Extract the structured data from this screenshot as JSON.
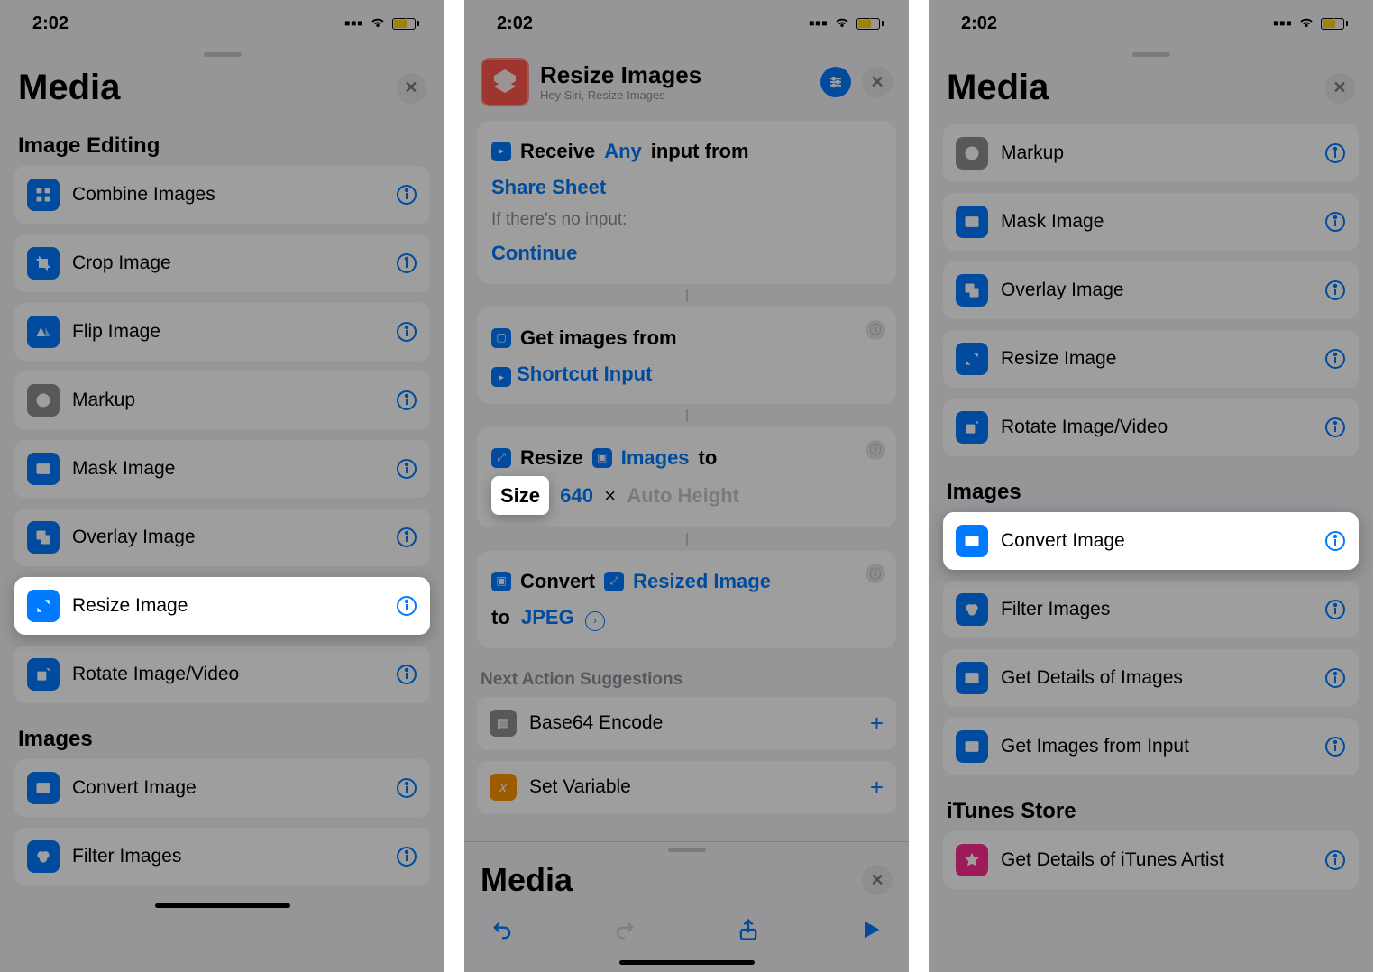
{
  "status": {
    "time": "2:02"
  },
  "phone1": {
    "sheet_title": "Media",
    "sections": [
      {
        "title": "Image Editing",
        "items": [
          {
            "icon": "grid",
            "label": "Combine Images"
          },
          {
            "icon": "crop",
            "label": "Crop Image"
          },
          {
            "icon": "flip",
            "label": "Flip Image"
          },
          {
            "icon": "markup",
            "label": "Markup",
            "gray": true
          },
          {
            "icon": "mask",
            "label": "Mask Image"
          },
          {
            "icon": "overlay",
            "label": "Overlay Image"
          },
          {
            "icon": "resize",
            "label": "Resize Image",
            "highlight": true
          },
          {
            "icon": "rotate",
            "label": "Rotate Image/Video"
          }
        ]
      },
      {
        "title": "Images",
        "items": [
          {
            "icon": "convert",
            "label": "Convert Image"
          },
          {
            "icon": "filter",
            "label": "Filter Images"
          }
        ]
      }
    ]
  },
  "phone2": {
    "shortcut_name": "Resize Images",
    "shortcut_sub": "Hey Siri, Resize Images",
    "receive": {
      "pre": "Receive",
      "any": "Any",
      "post": "input from",
      "share_sheet": "Share Sheet",
      "if_none": "If there's no input:",
      "continue": "Continue"
    },
    "get_images": {
      "text": "Get images from",
      "input": "Shortcut Input"
    },
    "resize": {
      "verb": "Resize",
      "var": "Images",
      "to": "to",
      "size_label": "Size",
      "width": "640",
      "times": "×",
      "auto": "Auto Height"
    },
    "convert": {
      "verb": "Convert",
      "var": "Resized Image",
      "to": "to",
      "format": "JPEG"
    },
    "next_suggestions_label": "Next Action Suggestions",
    "suggestions": [
      {
        "icon": "gray",
        "label": "Base64 Encode"
      },
      {
        "icon": "orange",
        "label": "Set Variable"
      }
    ],
    "bottom_sheet_title": "Media"
  },
  "phone3": {
    "sheet_title": "Media",
    "imgediting_tail": [
      {
        "icon": "markup",
        "label": "Markup",
        "gray": true
      },
      {
        "icon": "mask",
        "label": "Mask Image"
      },
      {
        "icon": "overlay",
        "label": "Overlay Image"
      },
      {
        "icon": "resize",
        "label": "Resize Image"
      },
      {
        "icon": "rotate",
        "label": "Rotate Image/Video"
      }
    ],
    "images_title": "Images",
    "images_items": [
      {
        "icon": "convert",
        "label": "Convert Image",
        "highlight": true
      },
      {
        "icon": "filter",
        "label": "Filter Images"
      },
      {
        "icon": "details",
        "label": "Get Details of Images"
      },
      {
        "icon": "getfrom",
        "label": "Get Images from Input"
      }
    ],
    "itunes_title": "iTunes Store",
    "itunes_items": [
      {
        "icon": "star",
        "label": "Get Details of iTunes Artist",
        "pink": true
      }
    ]
  }
}
